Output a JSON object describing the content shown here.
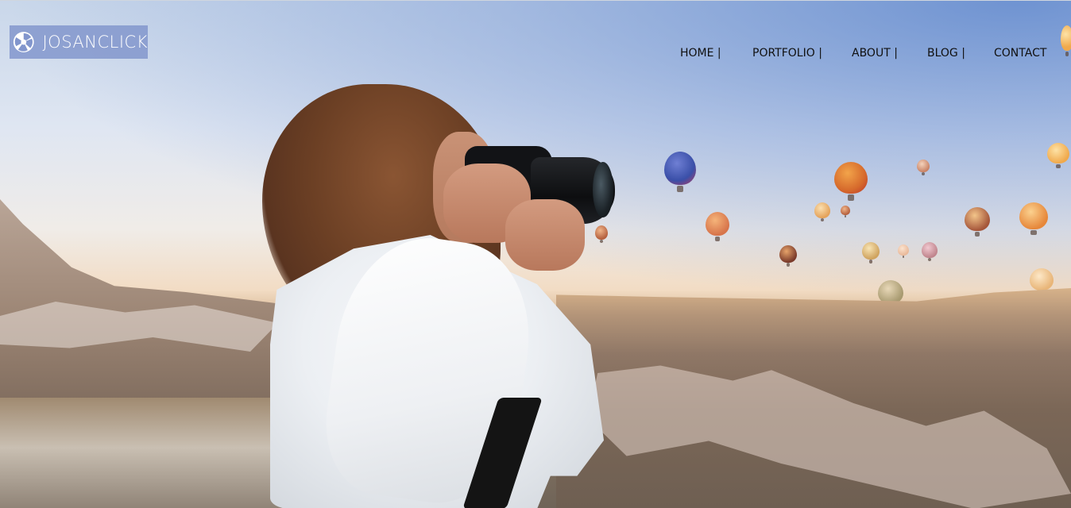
{
  "brand": {
    "logo_text": "JOSANCLICK",
    "logo_icon": "camera-shutter-icon",
    "logo_bg": "#8296cd"
  },
  "nav": {
    "items": [
      {
        "label": "HOME |"
      },
      {
        "label": "PORTFOLIO |"
      },
      {
        "label": "ABOUT |"
      },
      {
        "label": "BLOG |"
      },
      {
        "label": "CONTACT"
      }
    ]
  },
  "hero": {
    "image": "photographer-with-camera-and-hot-air-balloons"
  }
}
